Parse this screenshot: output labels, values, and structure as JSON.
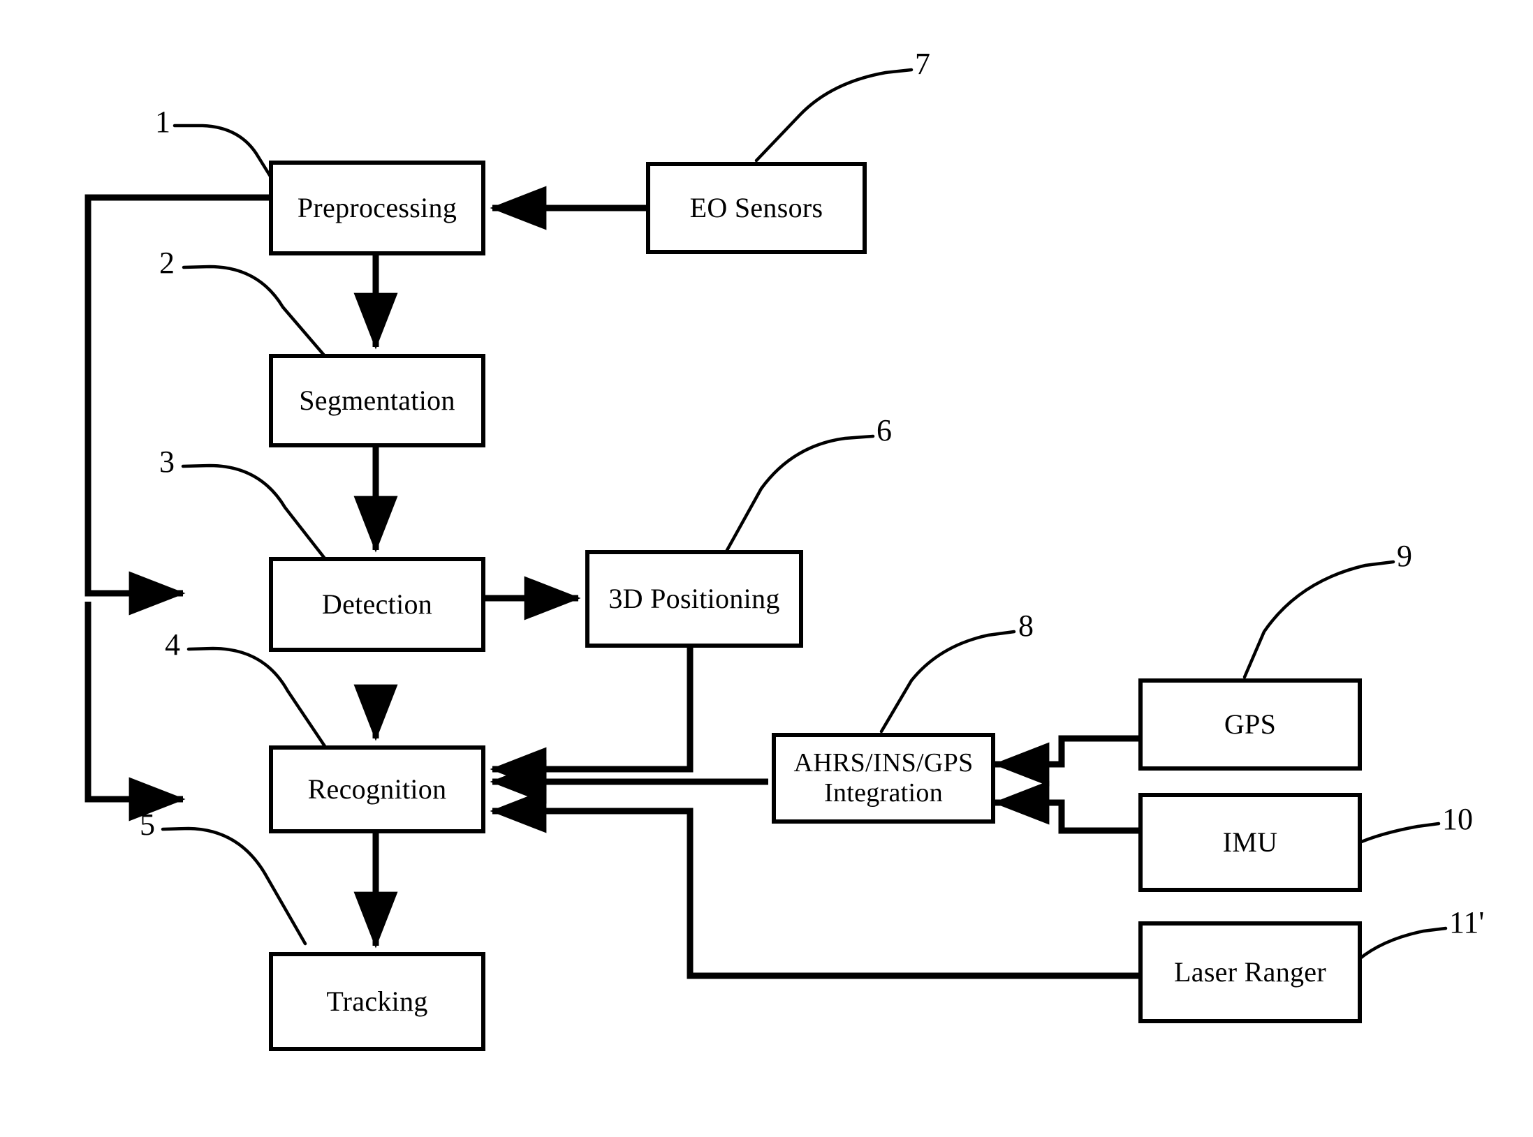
{
  "figure": {
    "kind": "block-diagram",
    "background_color": "#ffffff",
    "line_color": "#000000"
  },
  "nodes": {
    "preprocessing": {
      "label": "Preprocessing"
    },
    "eo_sensors": {
      "label": "EO Sensors"
    },
    "segmentation": {
      "label": "Segmentation"
    },
    "detection": {
      "label": "Detection"
    },
    "positioning_3d": {
      "label": "3D Positioning"
    },
    "recognition": {
      "label": "Recognition"
    },
    "tracking": {
      "label": "Tracking"
    },
    "ahrs_ins_gps": {
      "label": "AHRS/INS/GPS\nIntegration"
    },
    "gps": {
      "label": "GPS"
    },
    "imu": {
      "label": "IMU"
    },
    "laser_ranger": {
      "label": "Laser Ranger"
    }
  },
  "reference_numerals": {
    "preprocessing": "1",
    "segmentation": "2",
    "detection": "3",
    "recognition": "4",
    "tracking": "5",
    "positioning_3d": "6",
    "eo_sensors": "7",
    "ahrs_ins_gps": "8",
    "gps": "9",
    "imu": "10",
    "laser_ranger": "11'"
  }
}
